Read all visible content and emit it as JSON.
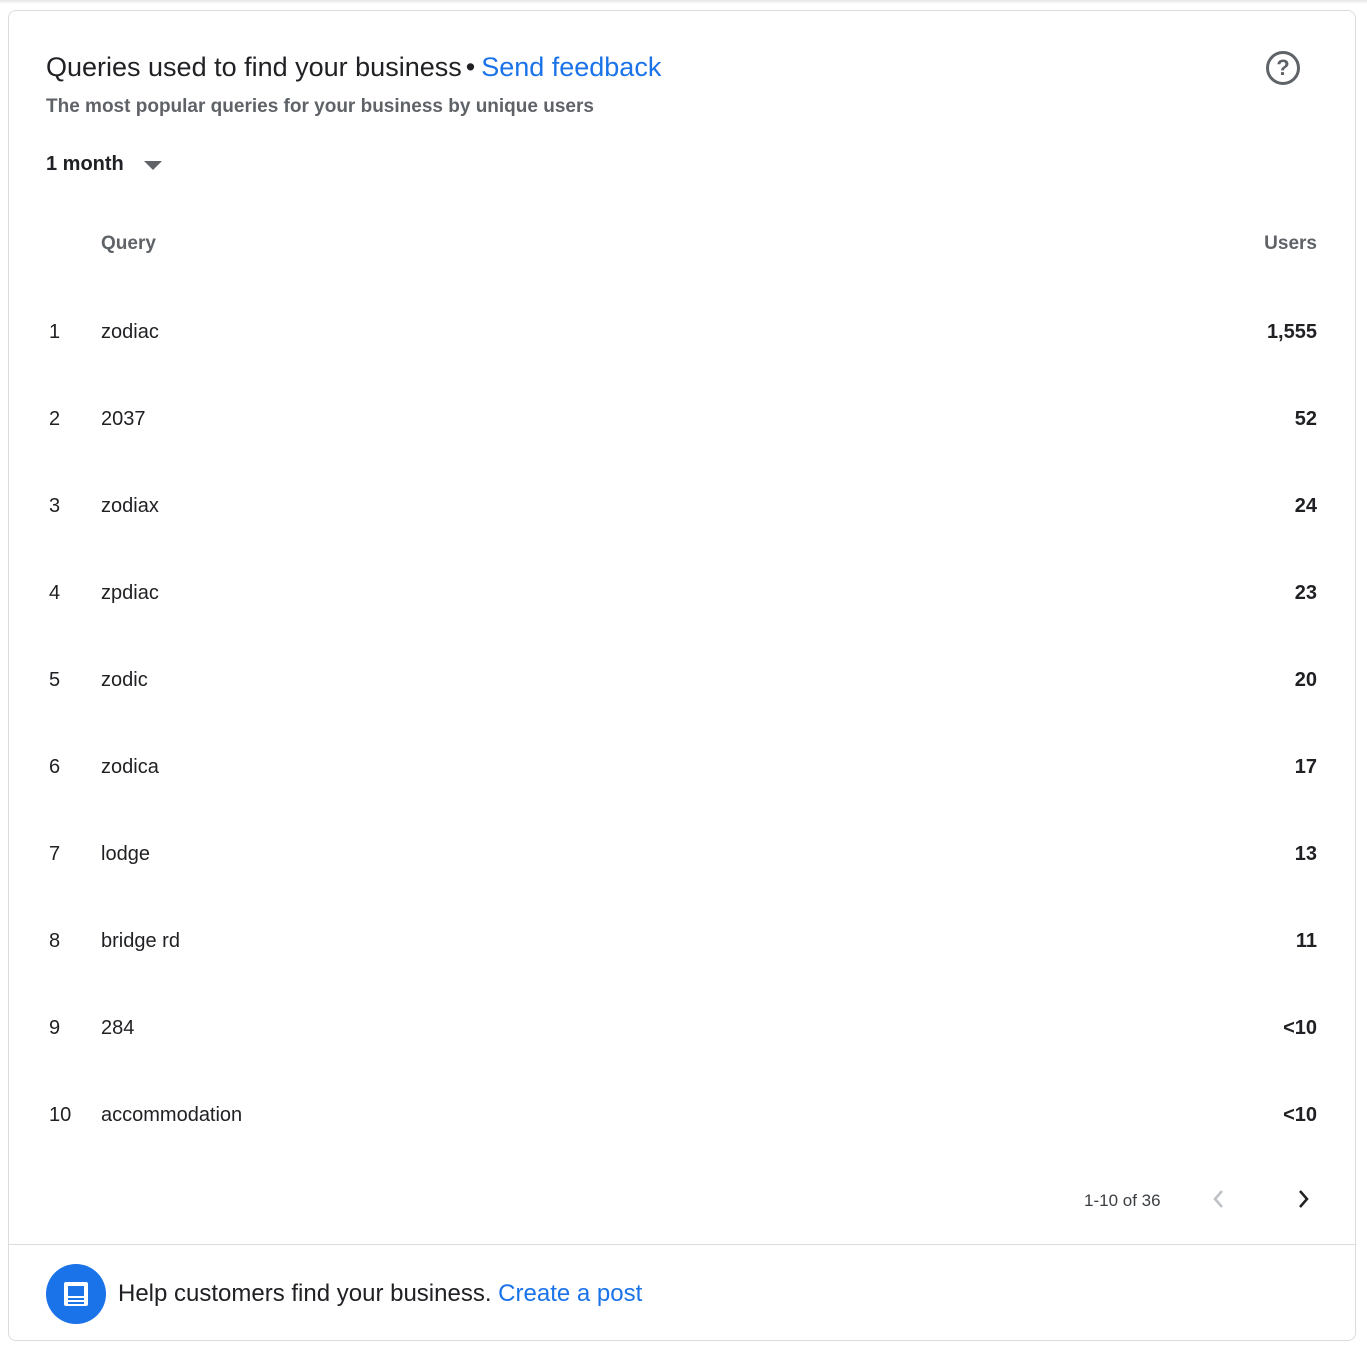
{
  "header": {
    "title": "Queries used to find your business",
    "separator": "•",
    "feedback_link": "Send feedback",
    "subtitle": "The most popular queries for your business by unique users",
    "help_icon": "help-circle-icon"
  },
  "filter": {
    "period_selected": "1 month"
  },
  "table": {
    "col_query": "Query",
    "col_users": "Users",
    "rows": [
      {
        "rank": "1",
        "query": "zodiac",
        "users": "1,555"
      },
      {
        "rank": "2",
        "query": "2037",
        "users": "52"
      },
      {
        "rank": "3",
        "query": "zodiax",
        "users": "24"
      },
      {
        "rank": "4",
        "query": "zpdiac",
        "users": "23"
      },
      {
        "rank": "5",
        "query": "zodic",
        "users": "20"
      },
      {
        "rank": "6",
        "query": "zodica",
        "users": "17"
      },
      {
        "rank": "7",
        "query": "lodge",
        "users": "13"
      },
      {
        "rank": "8",
        "query": "bridge rd",
        "users": "11"
      },
      {
        "rank": "9",
        "query": "284",
        "users": "<10"
      },
      {
        "rank": "10",
        "query": "accommodation",
        "users": "<10"
      }
    ]
  },
  "pagination": {
    "range_text": "1-10 of 36"
  },
  "footer": {
    "message": "Help customers find your business.",
    "link": "Create a post",
    "icon": "post-icon"
  },
  "colors": {
    "accent": "#1a73e8",
    "muted": "#5f6368",
    "border": "#dadce0"
  }
}
